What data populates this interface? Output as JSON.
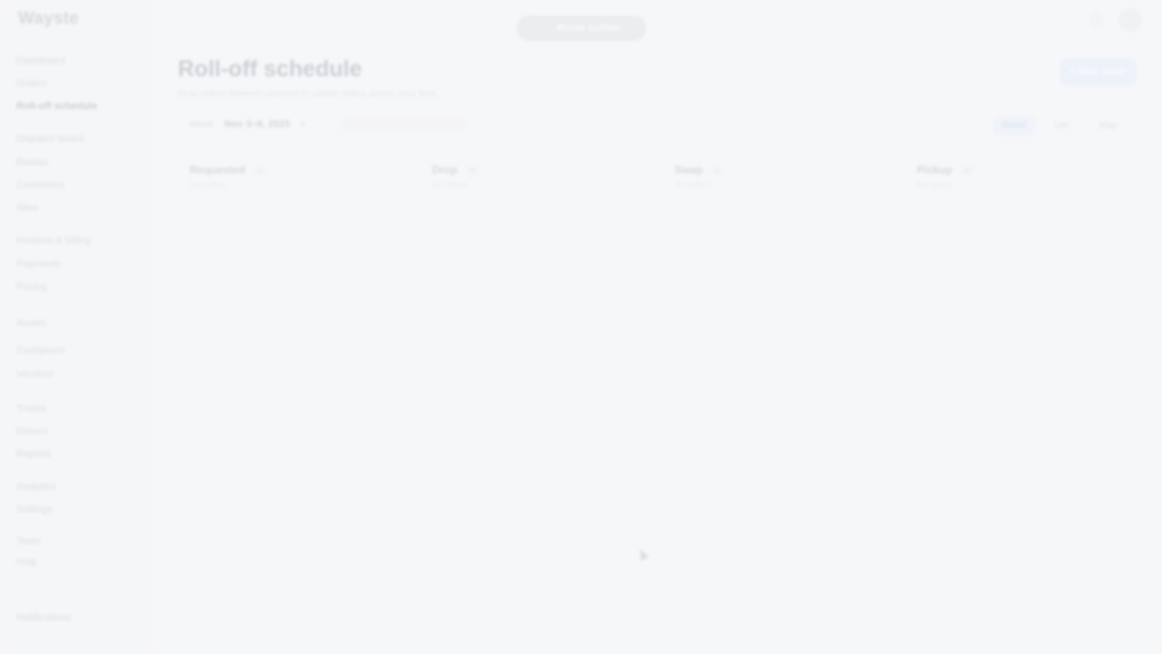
{
  "app": {
    "logo": "Wayste"
  },
  "banner": {
    "label": "Route builder"
  },
  "sidebar": {
    "items": [
      {
        "label": "Dashboard",
        "active": false
      },
      {
        "label": "Orders",
        "active": false
      },
      {
        "label": "Roll-off schedule",
        "active": true
      },
      {
        "label": "Dispatch board",
        "active": false
      },
      {
        "label": "Routes",
        "active": false
      },
      {
        "label": "Customers",
        "active": false
      },
      {
        "label": "Sites",
        "active": false
      },
      {
        "label": "Invoices & billing",
        "active": false
      },
      {
        "label": "Payments",
        "active": false
      },
      {
        "label": "Pricing",
        "active": false
      },
      {
        "label": "Assets",
        "active": false
      },
      {
        "label": "Containers",
        "active": false
      },
      {
        "label": "Vendors",
        "active": false
      },
      {
        "label": "Trucks",
        "active": false
      },
      {
        "label": "Drivers",
        "active": false
      },
      {
        "label": "Reports",
        "active": false
      },
      {
        "label": "Analytics",
        "active": false
      },
      {
        "label": "Settings",
        "active": false
      },
      {
        "label": "Team",
        "active": false
      },
      {
        "label": "Help",
        "active": false
      },
      {
        "label": "Notifications",
        "active": false
      }
    ]
  },
  "main": {
    "title": "Roll-off schedule",
    "subtitle": "Drag orders between columns to update status across your fleet.",
    "primary_action": "+ New order",
    "week_label": "Week",
    "week_value": "Nov 3–9, 2025",
    "view_options": [
      {
        "label": "Board",
        "active": true
      },
      {
        "label": "List",
        "active": false
      },
      {
        "label": "Map",
        "active": false
      }
    ],
    "columns": [
      {
        "name": "Requested",
        "count": "0",
        "sub": "No orders"
      },
      {
        "name": "Drop",
        "count": "0",
        "sub": "No orders"
      },
      {
        "name": "Swap",
        "count": "0",
        "sub": "No orders"
      },
      {
        "name": "Pickup",
        "count": "0",
        "sub": "No orders"
      }
    ]
  },
  "colors": {
    "background": "#f5f6f8",
    "accent": "#dbe9fa",
    "pill": "#d7dade"
  }
}
